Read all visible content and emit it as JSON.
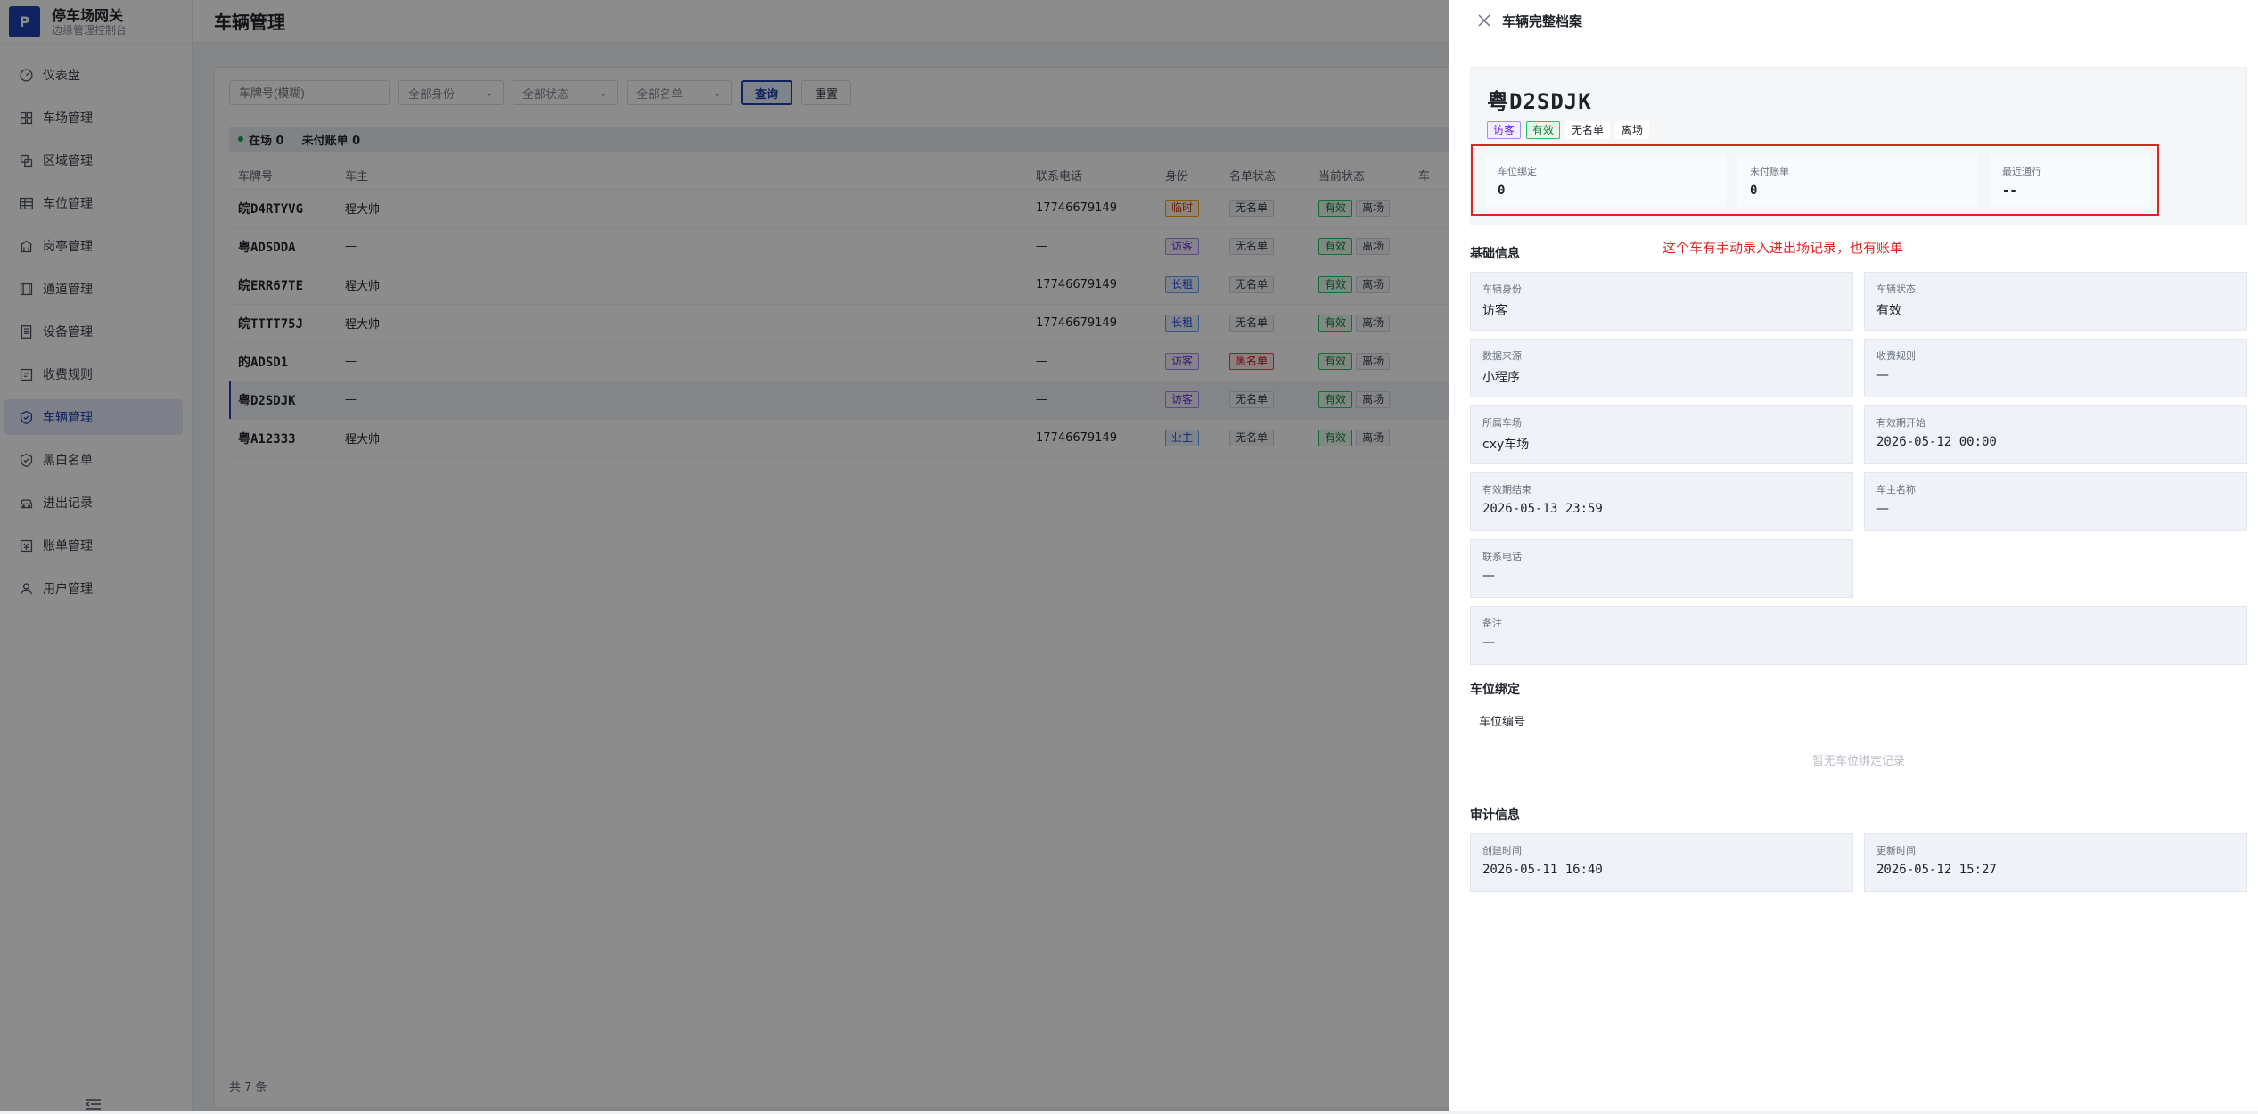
{
  "brand": {
    "logo": "P",
    "title": "停车场网关",
    "subtitle": "边缘管理控制台"
  },
  "sidebar": {
    "items": [
      {
        "label": "仪表盘",
        "icon": "gauge-icon"
      },
      {
        "label": "车场管理",
        "icon": "grid-icon"
      },
      {
        "label": "区域管理",
        "icon": "layers-icon"
      },
      {
        "label": "车位管理",
        "icon": "table-icon"
      },
      {
        "label": "岗亭管理",
        "icon": "building-icon"
      },
      {
        "label": "通道管理",
        "icon": "gate-icon"
      },
      {
        "label": "设备管理",
        "icon": "device-icon"
      },
      {
        "label": "收费规则",
        "icon": "rule-icon"
      },
      {
        "label": "车辆管理",
        "icon": "shield-icon",
        "active": true
      },
      {
        "label": "黑白名单",
        "icon": "shield-check-icon"
      },
      {
        "label": "进出记录",
        "icon": "car-icon"
      },
      {
        "label": "账单管理",
        "icon": "bill-icon"
      },
      {
        "label": "用户管理",
        "icon": "user-icon"
      }
    ]
  },
  "page": {
    "title": "车辆管理"
  },
  "filters": {
    "plate_placeholder": "车牌号(模糊)",
    "identity": "全部身份",
    "status": "全部状态",
    "list": "全部名单",
    "query": "查询",
    "reset": "重置"
  },
  "summary": {
    "in_lot": "在场 0",
    "unpaid": "未付账单 0"
  },
  "table": {
    "headers": [
      "车牌号",
      "车主",
      "联系电话",
      "身份",
      "名单状态",
      "当前状态",
      "车"
    ],
    "rows": [
      {
        "plate": "皖D4RTYVG",
        "owner": "程大帅",
        "phone": "17746679149",
        "identity": "临时",
        "identity_color": "orange",
        "list": "无名单",
        "list_color": "gray",
        "valid": "有效",
        "state": "离场"
      },
      {
        "plate": "粤ADSDDA",
        "owner": "—",
        "phone": "—",
        "identity": "访客",
        "identity_color": "purple",
        "list": "无名单",
        "list_color": "gray",
        "valid": "有效",
        "state": "离场"
      },
      {
        "plate": "皖ERR67TE",
        "owner": "程大帅",
        "phone": "17746679149",
        "identity": "长租",
        "identity_color": "blue",
        "list": "无名单",
        "list_color": "gray",
        "valid": "有效",
        "state": "离场"
      },
      {
        "plate": "皖TTTT75J",
        "owner": "程大帅",
        "phone": "17746679149",
        "identity": "长租",
        "identity_color": "blue",
        "list": "无名单",
        "list_color": "gray",
        "valid": "有效",
        "state": "离场"
      },
      {
        "plate": "的ADSD1",
        "owner": "—",
        "phone": "—",
        "identity": "访客",
        "identity_color": "purple",
        "list": "黑名单",
        "list_color": "red",
        "valid": "有效",
        "state": "离场"
      },
      {
        "plate": "粤D2SDJK",
        "owner": "—",
        "phone": "—",
        "identity": "访客",
        "identity_color": "purple",
        "list": "无名单",
        "list_color": "gray",
        "valid": "有效",
        "state": "离场",
        "selected": true
      },
      {
        "plate": "粤A12333",
        "owner": "程大帅",
        "phone": "17746679149",
        "identity": "业主",
        "identity_color": "blue",
        "list": "无名单",
        "list_color": "gray",
        "valid": "有效",
        "state": "离场"
      }
    ],
    "total": "共 7 条"
  },
  "drawer": {
    "title": "车辆完整档案",
    "plate": "粤D2SDJK",
    "tags": [
      "访客",
      "有效",
      "无名单",
      "离场"
    ],
    "stats": [
      {
        "label": "车位绑定",
        "value": "0"
      },
      {
        "label": "未付账单",
        "value": "0"
      },
      {
        "label": "最近通行",
        "value": "--"
      }
    ],
    "annotation": "这个车有手动录入进出场记录，也有账单",
    "basic_title": "基础信息",
    "basic": [
      {
        "label": "车辆身份",
        "value": "访客"
      },
      {
        "label": "车辆状态",
        "value": "有效"
      },
      {
        "label": "数据来源",
        "value": "小程序"
      },
      {
        "label": "收费规则",
        "value": "—"
      },
      {
        "label": "所属车场",
        "value": "cxy车场"
      },
      {
        "label": "有效期开始",
        "value": "2026-05-12 00:00"
      },
      {
        "label": "有效期结束",
        "value": "2026-05-13 23:59"
      },
      {
        "label": "车主名称",
        "value": "—"
      },
      {
        "label": "联系电话",
        "value": "—"
      },
      {
        "label": "备注",
        "value": "—"
      }
    ],
    "binding_title": "车位绑定",
    "binding_col": "车位编号",
    "binding_empty": "暂无车位绑定记录",
    "audit_title": "审计信息",
    "audit": [
      {
        "label": "创建时间",
        "value": "2026-05-11 16:40"
      },
      {
        "label": "更新时间",
        "value": "2026-05-12 15:27"
      }
    ]
  }
}
